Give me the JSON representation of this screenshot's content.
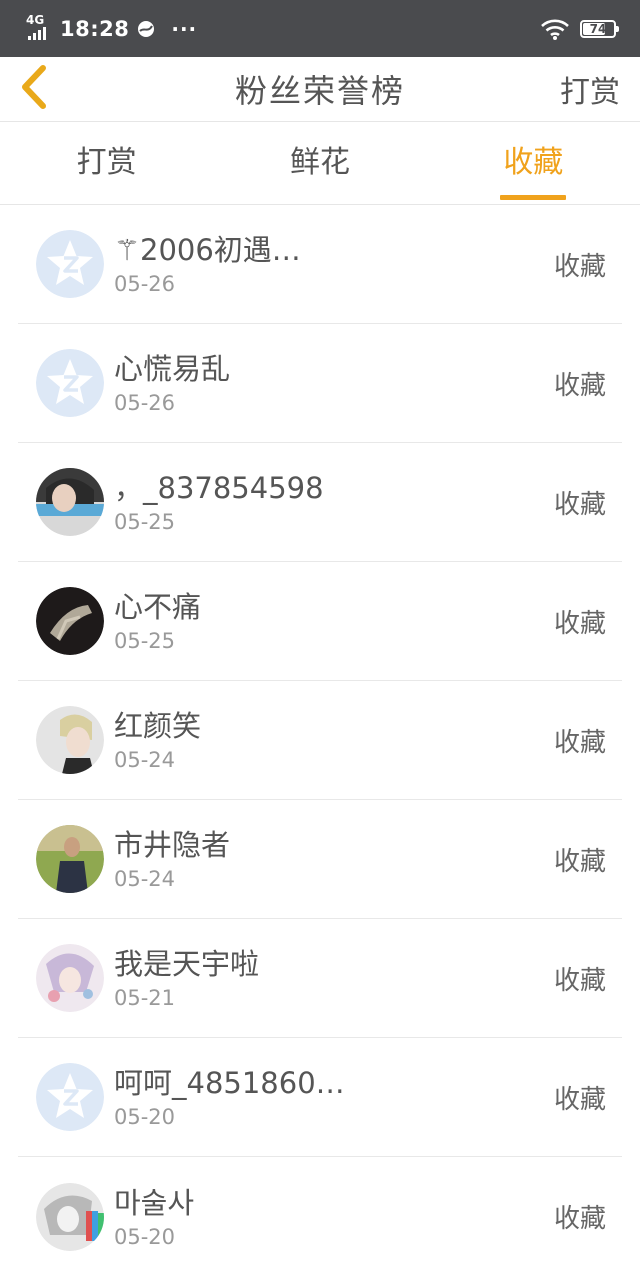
{
  "status_bar": {
    "network": "4G",
    "time": "18:28",
    "more": "···",
    "battery": "74",
    "battery_level": 0.74
  },
  "nav": {
    "title": "粉丝荣誉榜",
    "right_action": "打赏"
  },
  "tabs": [
    {
      "label": "打赏",
      "active": false
    },
    {
      "label": "鲜花",
      "active": false
    },
    {
      "label": "收藏",
      "active": true
    }
  ],
  "colors": {
    "accent": "#f0a21c",
    "text": "#555555",
    "subtext": "#999999",
    "statusbar": "#4a4b4e"
  },
  "rows": [
    {
      "name": "⚚2006初遇…",
      "date": "05-26",
      "action": "收藏",
      "avatar": "default-star-avatar"
    },
    {
      "name": "心慌易乱",
      "date": "05-26",
      "action": "收藏",
      "avatar": "default-star-avatar"
    },
    {
      "name": "，_837854598",
      "date": "05-25",
      "action": "收藏",
      "avatar": "photo-avatar"
    },
    {
      "name": "心不痛",
      "date": "05-25",
      "action": "收藏",
      "avatar": "photo-avatar"
    },
    {
      "name": "红颜笑",
      "date": "05-24",
      "action": "收藏",
      "avatar": "photo-avatar"
    },
    {
      "name": "市井隐者",
      "date": "05-24",
      "action": "收藏",
      "avatar": "photo-avatar"
    },
    {
      "name": "我是天宇啦",
      "date": "05-21",
      "action": "收藏",
      "avatar": "photo-avatar"
    },
    {
      "name": "呵呵_4851860…",
      "date": "05-20",
      "action": "收藏",
      "avatar": "default-star-avatar"
    },
    {
      "name": "마술사",
      "date": "05-20",
      "action": "收藏",
      "avatar": "photo-avatar"
    }
  ]
}
